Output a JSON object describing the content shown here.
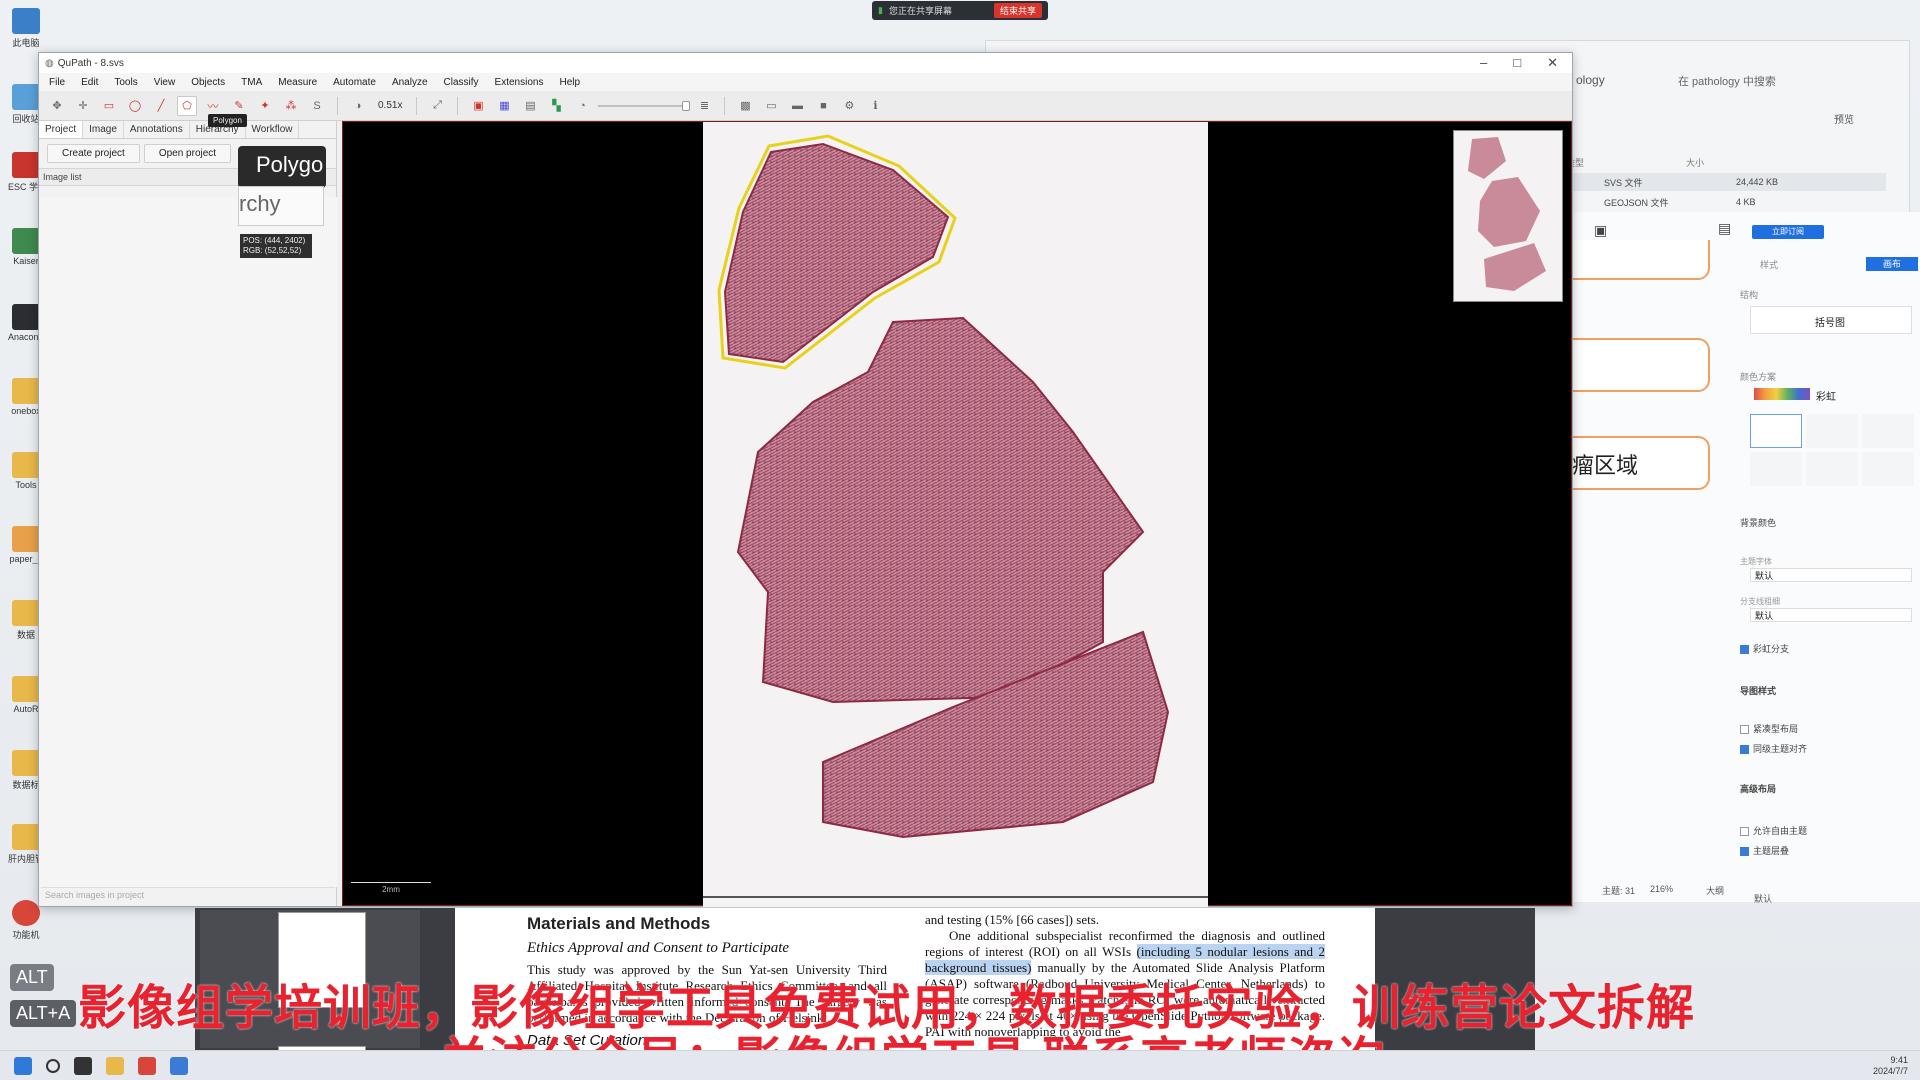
{
  "share_bar": {
    "status": "您正在共享屏幕",
    "stop_label": "结束共享"
  },
  "desktop_icons": [
    {
      "label": "此电脑"
    },
    {
      "label": "回收站"
    },
    {
      "label": "ESC 学习"
    },
    {
      "label": "Kaiser"
    },
    {
      "label": "Anaconda Prompt"
    },
    {
      "label": "onebox"
    },
    {
      "label": "Tools"
    },
    {
      "label": "paper_d"
    },
    {
      "label": "数据"
    },
    {
      "label": "AutoR"
    },
    {
      "label": "数据标"
    },
    {
      "label": "肝内胆管癌"
    },
    {
      "label": "功能机"
    }
  ],
  "bg_window": {
    "title": "ology",
    "search_placeholder": "在 pathology 中搜索",
    "preview_label": "预览",
    "cols": [
      "类型",
      "大小"
    ],
    "rows": [
      {
        "type": "SVS 文件",
        "size": "24,442 KB"
      },
      {
        "type": "GEOJSON 文件",
        "size": "4 KB"
      }
    ]
  },
  "mindmap": {
    "node_text": "瘤区域",
    "top_button": "立即订阅",
    "tabs": [
      "样式",
      "画布"
    ],
    "sections": {
      "structure_label": "结构",
      "structure_value": "括号图",
      "color_label": "颜色方案",
      "color_value": "彩虹",
      "bg_label": "背景颜色",
      "font_label": "主题字体",
      "font_value": "默认",
      "line_label": "分支线粗细",
      "line_value": "默认",
      "rainbow_branch": "彩虹分支",
      "map_style": "导图样式",
      "compact": "紧凑型布局",
      "align": "同级主题对齐",
      "advanced": "高级布局",
      "free_topic": "允许自由主题",
      "overlap": "主题层叠",
      "bottom_left": "主题: 31",
      "zoom": "216%",
      "size": "大纲",
      "default": "默认"
    }
  },
  "qupath": {
    "title": "QuPath - 8.svs",
    "menu": [
      "File",
      "Edit",
      "Tools",
      "View",
      "Objects",
      "TMA",
      "Measure",
      "Automate",
      "Analyze",
      "Classify",
      "Extensions",
      "Help"
    ],
    "zoom": "0.51x",
    "tabs": [
      "Project",
      "Image",
      "Annotations",
      "Hierarchy",
      "Workflow"
    ],
    "create_project": "Create project",
    "open_project": "Open project",
    "image_list": "Image list",
    "search_placeholder": "Search images in project",
    "tooltip_small": "Polygon",
    "tooltip_big": "Polygo",
    "tooltip_frag": "rchy",
    "pos": "POS: (444, 2402)",
    "rgb": "RGB: (52,52,52)",
    "scalebar": "2mm"
  },
  "document": {
    "h1": "Materials and Methods",
    "h2": "Ethics Approval and Consent to Participate",
    "left": "This study was approved by the Sun Yat-sen University Third Affiliated Hospital Institute Research Ethics Committee, and all participants provided written informed consent. The surgery was performed in accordance with the Declaration of Helsinki.",
    "right_pre": "and testing (15% [66 cases]) sets.",
    "right_body": "One additional subspecialist reconfirmed the diagnosis and outlined regions of interest (ROI) on all WSIs",
    "right_hl": "(including 5 nodular lesions and 2 background tissues)",
    "right_post": "manually by the Automated Slide Analysis Platform (ASAP) software (Radboud University Medical Center, Netherlands) to generate corresponding masks. Patches in ROI were automatically extracted with 224 × 224 pixels at 40× using the OpenSlide Python software package. PAI with nonoverlapping to avoid the",
    "h3": "Data Set Curation"
  },
  "banner": {
    "line1": "影像组学培训班，影像组学工具免费试用，数据委托实验，训练营论文拆解",
    "line2": "关注公众号：影像组学工具 联系高老师咨询"
  },
  "alt_keys": [
    "ALT",
    "ALT+A"
  ],
  "tray": {
    "time": "9:41",
    "date": "2024/7/7"
  }
}
